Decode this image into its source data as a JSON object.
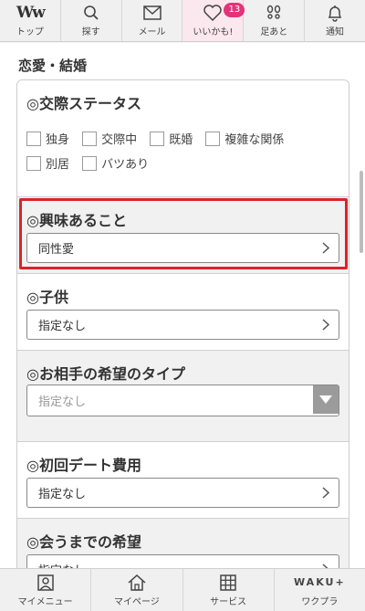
{
  "top_nav": [
    {
      "label": "トップ",
      "icon": "ww-logo-icon",
      "logo_text": "Ww"
    },
    {
      "label": "探す",
      "icon": "search-icon"
    },
    {
      "label": "メール",
      "icon": "mail-icon"
    },
    {
      "label": "いいかも!",
      "icon": "heart-icon",
      "badge": "13"
    },
    {
      "label": "足あと",
      "icon": "footprint-icon"
    },
    {
      "label": "通知",
      "icon": "bell-icon"
    }
  ],
  "section_title": "恋愛・結婚",
  "relationship_status": {
    "title": "◎交際ステータス",
    "options": [
      "独身",
      "交際中",
      "既婚",
      "複雑な関係",
      "別居",
      "バツあり"
    ]
  },
  "interests": {
    "title": "◎興味あること",
    "value": "同性愛"
  },
  "children": {
    "title": "◎子供",
    "value": "指定なし"
  },
  "partner_type": {
    "title": "◎お相手の希望のタイプ",
    "placeholder": "指定なし"
  },
  "first_date_cost": {
    "title": "◎初回デート費用",
    "value": "指定なし"
  },
  "before_meeting": {
    "title": "◎会うまでの希望",
    "value": "指定なし"
  },
  "bottom_nav": [
    {
      "label": "マイメニュー",
      "icon": "profile-icon"
    },
    {
      "label": "マイページ",
      "icon": "home-icon"
    },
    {
      "label": "サービス",
      "icon": "grid-icon"
    },
    {
      "label": "ワクプラ",
      "icon": "waku-plus-logo",
      "logo_text": "WAKU+"
    }
  ],
  "colors": {
    "accent_pink": "#e4337a",
    "highlight_red": "#d9242b"
  }
}
